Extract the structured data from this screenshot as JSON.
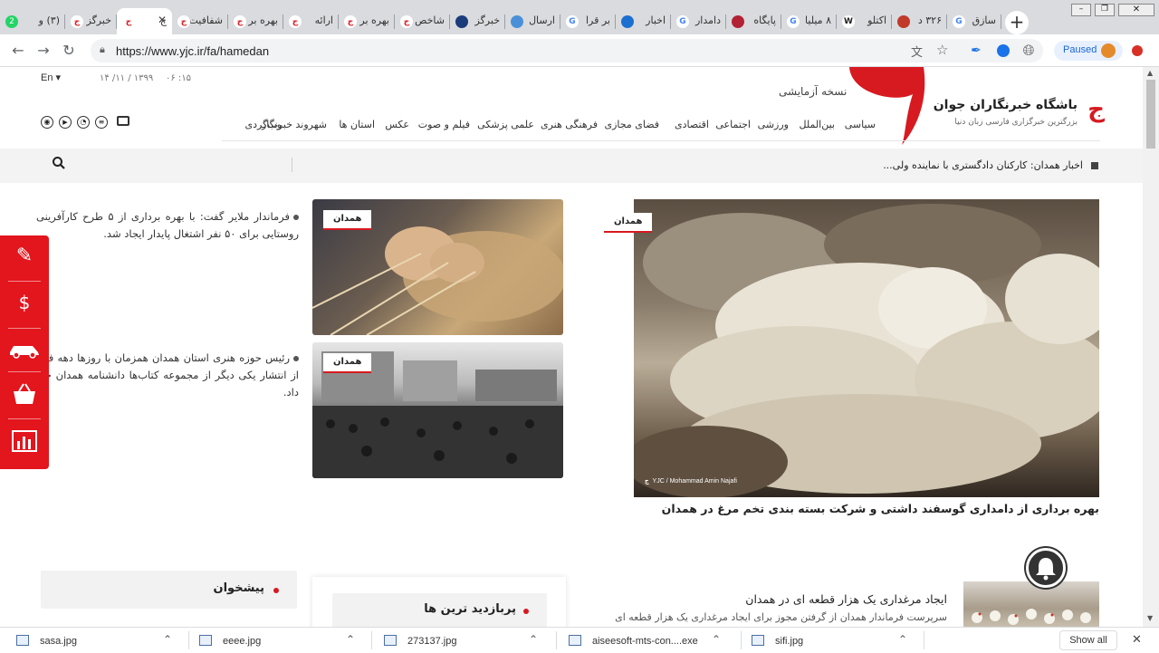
{
  "browser": {
    "tabs": [
      {
        "label": "(۳) و",
        "icon": "whatsapp-icon",
        "color": "#25d366",
        "badge": "2"
      },
      {
        "label": "خبرگز",
        "icon": "yjc-icon",
        "color": "#d71920"
      },
      {
        "label": "ج",
        "icon": "yjc-icon",
        "color": "#d71920",
        "active": true
      },
      {
        "label": "شفافیت",
        "icon": "yjc-icon",
        "color": "#d71920"
      },
      {
        "label": "بهره بر",
        "icon": "yjc-icon",
        "color": "#d71920"
      },
      {
        "label": "ارائه",
        "icon": "yjc-icon",
        "color": "#d71920"
      },
      {
        "label": "بهره بر",
        "icon": "yjc-icon",
        "color": "#d71920"
      },
      {
        "label": "شاخص",
        "icon": "yjc-icon",
        "color": "#d71920"
      },
      {
        "label": "خبرگز",
        "icon": "news-icon",
        "color": "#1a3c7a"
      },
      {
        "label": "ارسال",
        "icon": "mail-icon",
        "color": "#4a90d9"
      },
      {
        "label": "بر قرا",
        "icon": "google-icon",
        "color": "#4285f4"
      },
      {
        "label": "اخبار",
        "icon": "news-icon",
        "color": "#1b6fd1"
      },
      {
        "label": "دامدار",
        "icon": "google-icon",
        "color": "#4285f4"
      },
      {
        "label": "پایگاه",
        "icon": "iran-icon",
        "color": "#b22234"
      },
      {
        "label": "۸ میلیا",
        "icon": "google-icon",
        "color": "#4285f4"
      },
      {
        "label": "اکتلو",
        "icon": "wikipedia-icon",
        "color": "#222222"
      },
      {
        "label": "۳۲۶ د",
        "icon": "news-icon",
        "color": "#c0392b"
      },
      {
        "label": "سازق",
        "icon": "google-icon",
        "color": "#4285f4"
      }
    ],
    "url": "https://www.yjc.ir/fa/hamedan",
    "profile_label": "Paused"
  },
  "header": {
    "lang": "En",
    "date": "۱۳۹۹ / ۱۱/ ۱۴",
    "time": "۱۵: ۰۶",
    "beta": "نسخه آزمایشی",
    "site_name": "باشگاه خبرنگاران جوان",
    "tagline": "بزرگترین خبرگزاری فارسی زبان دنیا",
    "brand_color": "#d71920",
    "nav": [
      "سیاسی",
      "بین‌الملل",
      "ورزشی",
      "اجتماعی",
      "اقتصادی",
      "فضای مجازی",
      "فرهنگی هنری",
      "علمی پزشکی",
      "فیلم و صوت",
      "عکس",
      "استان ها",
      "شهروند خبرنگار",
      "وب‌گردی"
    ]
  },
  "ticker": {
    "text": "اخبار همدان: کارکنان دادگستری با نماینده ولی..."
  },
  "main_story": {
    "tag": "همدان",
    "credit": "YJC / Mohammad Amin Najafi",
    "headline": "بهره برداری از دامداری گوسفند داشتی و شرکت بسته بندی تخم مرغ در همدان"
  },
  "side_stories": [
    {
      "tag": "همدان",
      "text": "فرماندار ملایر گفت: با بهره برداری از ۵ طرح کارآفرینی روستایی برای ۵۰ نفر اشتغال پایدار ایجاد شد."
    },
    {
      "tag": "همدان",
      "text": "رئیس حوزه هنری استان همدان همزمان با روزها دهه فجر از انتشار یکی دیگر از مجموعه کتاب‌ها دانشنامه همدان خبر داد."
    }
  ],
  "sections": {
    "suggested": "پیشخوان",
    "most_visited": "پربازدید ترین ها"
  },
  "list_story": {
    "title": "ایجاد مرغداری یک هزار قطعه ای در همدان",
    "summary": "سرپرست فرماندار همدان از گرفتن مجوز برای ایجاد مرغداری یک هزار قطعه ای"
  },
  "downloads": {
    "items": [
      "sasa.jpg",
      "eeee.jpg",
      "273137.jpg",
      "aiseesoft-mts-con....exe",
      "sifi.jpg"
    ],
    "show_all": "Show all"
  }
}
